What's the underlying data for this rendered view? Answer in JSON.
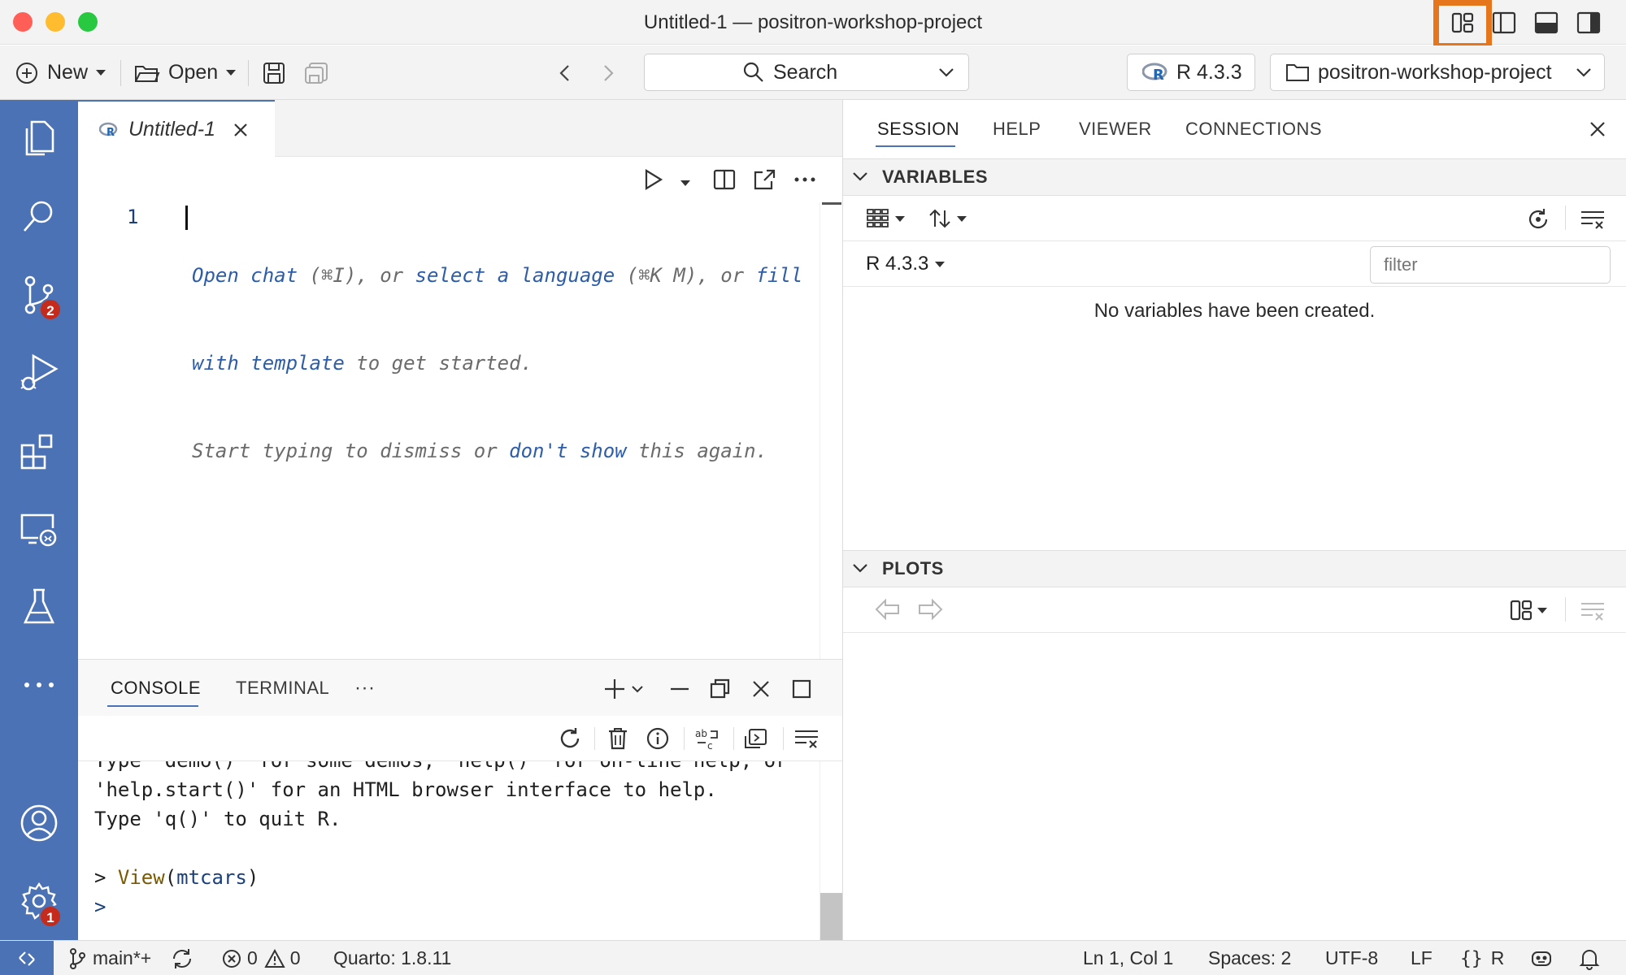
{
  "window": {
    "title": "Untitled-1 — positron-workshop-project"
  },
  "toolbar": {
    "new_label": "New",
    "open_label": "Open",
    "search_label": "Search",
    "interpreter_label": "R 4.3.3",
    "project_label": "positron-workshop-project"
  },
  "activity_bar": {
    "source_control_badge": "2",
    "settings_badge": "1"
  },
  "editor": {
    "tab_label": "Untitled-1",
    "line_number": "1",
    "hint": {
      "line1_open_chat": "Open chat",
      "line1_shortcut_chat": " (⌘I), or ",
      "line1_select_language": "select a language",
      "line1_shortcut_lang": " (⌘K M), or ",
      "line1_fill": "fill",
      "line2_with_template": "with template",
      "line2_rest": " to get started.",
      "line3_start": "Start typing to dismiss or ",
      "line3_dont_show": "don't show",
      "line3_end": " this again."
    }
  },
  "console": {
    "tabs": [
      "CONSOLE",
      "TERMINAL"
    ],
    "more_label": "···",
    "lines": {
      "cut_off": "Type 'demo()' for some demos, 'help()' for on-line help, or",
      "help_start": "'help.start()' for an HTML browser interface to help.",
      "quit": "Type 'q()' to quit R.",
      "prompt1": ">",
      "call_fn": "View",
      "call_open": "(",
      "call_arg": "mtcars",
      "call_close": ")",
      "prompt2": ">"
    }
  },
  "right_pane": {
    "tabs": [
      "SESSION",
      "HELP",
      "VIEWER",
      "CONNECTIONS"
    ],
    "variables": {
      "header": "VARIABLES",
      "session_label": "R 4.3.3",
      "filter_placeholder": "filter",
      "empty_message": "No variables have been created."
    },
    "plots": {
      "header": "PLOTS"
    }
  },
  "statusbar": {
    "branch": "main*+",
    "errors": "0",
    "warnings": "0",
    "quarto": "Quarto: 1.8.11",
    "position": "Ln 1, Col 1",
    "spaces": "Spaces: 2",
    "encoding": "UTF-8",
    "eol": "LF",
    "language": "R"
  },
  "colors": {
    "activity_bar": "#4a72b4",
    "highlight": "#e5761b",
    "badge": "#c42b1c",
    "link": "#2d5da8"
  }
}
